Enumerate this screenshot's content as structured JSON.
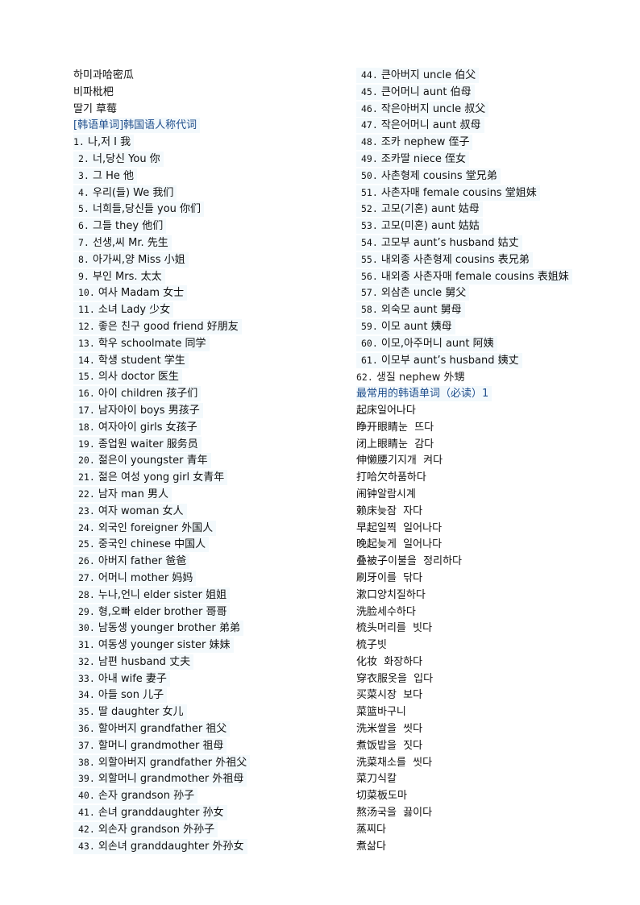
{
  "left_column": {
    "intro": [
      "하미과哈密瓜",
      "비파枇杷",
      "딸기  草莓"
    ],
    "heading": "[韩语单词]韩国语人称代词",
    "items": [
      {
        "num": "1.",
        "text": "나,저 I 我"
      },
      {
        "num": "2.",
        "text": "너,당신 You 你"
      },
      {
        "num": "3.",
        "text": "그 He 他"
      },
      {
        "num": "4.",
        "text": "우리(들) We 我们"
      },
      {
        "num": "5.",
        "text": "너희들,당신들 you 你们"
      },
      {
        "num": "6.",
        "text": "그들 they 他们"
      },
      {
        "num": "7.",
        "text": "선생,씨 Mr. 先生"
      },
      {
        "num": "8.",
        "text": "아가씨,양 Miss 小姐"
      },
      {
        "num": "9.",
        "text": "부인 Mrs. 太太"
      },
      {
        "num": "10.",
        "text": "여사 Madam 女士"
      },
      {
        "num": "11.",
        "text": "소녀 Lady 少女"
      },
      {
        "num": "12.",
        "text": "좋은 친구 good friend 好朋友"
      },
      {
        "num": "13.",
        "text": "학우 schoolmate 同学"
      },
      {
        "num": "14.",
        "text": "학생 student 学生"
      },
      {
        "num": "15.",
        "text": "의사 doctor 医生"
      },
      {
        "num": "16.",
        "text": "아이 children 孩子们"
      },
      {
        "num": "17.",
        "text": "남자아이 boys 男孩子"
      },
      {
        "num": "18.",
        "text": "여자아이 girls 女孩子"
      },
      {
        "num": "19.",
        "text": "종업원 waiter 服务员"
      },
      {
        "num": "20.",
        "text": "젊은이 youngster 青年"
      },
      {
        "num": "21.",
        "text": "젊은 여성 yong girl 女青年"
      },
      {
        "num": "22.",
        "text": "남자 man 男人"
      },
      {
        "num": "23.",
        "text": "여자 woman 女人"
      },
      {
        "num": "24.",
        "text": "외국인 foreigner 外国人"
      },
      {
        "num": "25.",
        "text": "중국인 chinese 中国人"
      },
      {
        "num": "26.",
        "text": "아버지 father 爸爸"
      },
      {
        "num": "27.",
        "text": "어머니 mother 妈妈"
      },
      {
        "num": "28.",
        "text": "누나,언니 elder sister 姐姐"
      },
      {
        "num": "29.",
        "text": "형,오빠 elder brother 哥哥"
      },
      {
        "num": "30.",
        "text": "남동생 younger brother 弟弟"
      },
      {
        "num": "31.",
        "text": "여동생 younger sister 妹妹"
      },
      {
        "num": "32.",
        "text": "남편 husband 丈夫"
      },
      {
        "num": "33.",
        "text": "아내 wife 妻子"
      },
      {
        "num": "34.",
        "text": "아들 son 儿子"
      },
      {
        "num": "35.",
        "text": "딸 daughter 女儿"
      },
      {
        "num": "36.",
        "text": "할아버지 grandfather 祖父"
      },
      {
        "num": "37.",
        "text": "할머니 grandmother 祖母"
      },
      {
        "num": "38.",
        "text": "외할아버지 grandfather 外祖父"
      },
      {
        "num": "39.",
        "text": "외할머니 grandmother 外祖母"
      },
      {
        "num": "40.",
        "text": "손자 grandson 孙子"
      },
      {
        "num": "41.",
        "text": "손녀 granddaughter 孙女"
      },
      {
        "num": "42.",
        "text": "외손자 grandson 外孙子"
      },
      {
        "num": "43.",
        "text": "외손녀 granddaughter 外孙女"
      }
    ]
  },
  "right_column": {
    "items": [
      {
        "num": "44.",
        "text": "큰아버지 uncle 伯父"
      },
      {
        "num": "45.",
        "text": "큰어머니 aunt 伯母"
      },
      {
        "num": "46.",
        "text": "작은아버지 uncle 叔父"
      },
      {
        "num": "47.",
        "text": "작은어머니 aunt 叔母"
      },
      {
        "num": "48.",
        "text": "조카 nephew 侄子"
      },
      {
        "num": "49.",
        "text": "조카딸 niece 侄女"
      },
      {
        "num": "50.",
        "text": "사촌형제 cousins 堂兄弟"
      },
      {
        "num": "51.",
        "text": "사촌자매 female cousins 堂姐妹"
      },
      {
        "num": "52.",
        "text": "고모(기혼) aunt 姑母"
      },
      {
        "num": "53.",
        "text": "고모(미혼) aunt 姑姑"
      },
      {
        "num": "54.",
        "text": "고모부 aunt’s husband 姑丈"
      },
      {
        "num": "55.",
        "text": "내외종 사촌형제 cousins 表兄弟"
      },
      {
        "num": "56.",
        "text": "내외종 사촌자매 female cousins 表姐妹"
      },
      {
        "num": "57.",
        "text": "외삼촌 uncle 舅父"
      },
      {
        "num": "58.",
        "text": "외숙모 aunt 舅母"
      },
      {
        "num": "59.",
        "text": "이모 aunt 姨母"
      },
      {
        "num": "60.",
        "text": "이모,아주머니 aunt 阿姨"
      },
      {
        "num": "61.",
        "text": "이모부 aunt’s husband 姨丈"
      }
    ],
    "item62": {
      "num": "62.",
      "text": "생질  nephew 外甥"
    },
    "heading": "最常用的韩语单词（必读）1",
    "phrases": [
      "起床일어나다",
      "睁开眼睛눈  뜨다",
      "闭上眼睛눈  감다",
      "伸懒腰기지개  켜다",
      "打哈欠하품하다",
      "闹钟알람시계",
      "赖床늦잠  자다",
      "早起일찍  일어나다",
      "晚起늦게  일어나다",
      "叠被子이불을  정리하다",
      "刷牙이를  닦다",
      "漱口양치질하다",
      "洗脸세수하다",
      "梳头머리를  빗다",
      "梳子빗",
      "化妆  화장하다",
      "穿衣服옷을  입다",
      "买菜시장  보다",
      "菜篮바구니",
      "洗米쌀을  씻다",
      "煮饭밥을  짓다",
      "洗菜채소를  씻다",
      "菜刀식칼",
      "切菜板도마",
      "熬汤국을  끓이다",
      "蒸찌다",
      "煮삶다"
    ]
  }
}
